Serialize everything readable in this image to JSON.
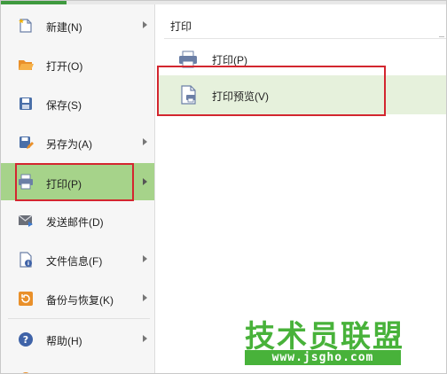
{
  "menu": {
    "items": [
      {
        "label": "新建(N)",
        "icon": "new-file-icon",
        "submenu": true
      },
      {
        "label": "打开(O)",
        "icon": "open-folder-icon",
        "submenu": false
      },
      {
        "label": "保存(S)",
        "icon": "save-icon",
        "submenu": false
      },
      {
        "label": "另存为(A)",
        "icon": "save-as-icon",
        "submenu": true
      },
      {
        "label": "打印(P)",
        "icon": "printer-icon",
        "submenu": true,
        "active": true
      },
      {
        "label": "发送邮件(D)",
        "icon": "mail-icon",
        "submenu": false
      },
      {
        "label": "文件信息(F)",
        "icon": "file-info-icon",
        "submenu": true
      },
      {
        "label": "备份与恢复(K)",
        "icon": "backup-icon",
        "submenu": true
      },
      {
        "label": "帮助(H)",
        "icon": "help-icon",
        "submenu": true
      }
    ]
  },
  "submenu": {
    "title": "打印",
    "items": [
      {
        "label": "打印(P)",
        "icon": "printer-icon"
      },
      {
        "label": "打印预览(V)",
        "icon": "print-preview-icon",
        "hovered": true
      }
    ]
  },
  "watermark": {
    "text": "技术员联盟",
    "url": "www.jsgho.com"
  },
  "colors": {
    "active_bg": "#a6d38a",
    "hover_bg": "#e6f1dc",
    "highlight_border": "#d3262f",
    "brand_green": "#48b23a"
  }
}
